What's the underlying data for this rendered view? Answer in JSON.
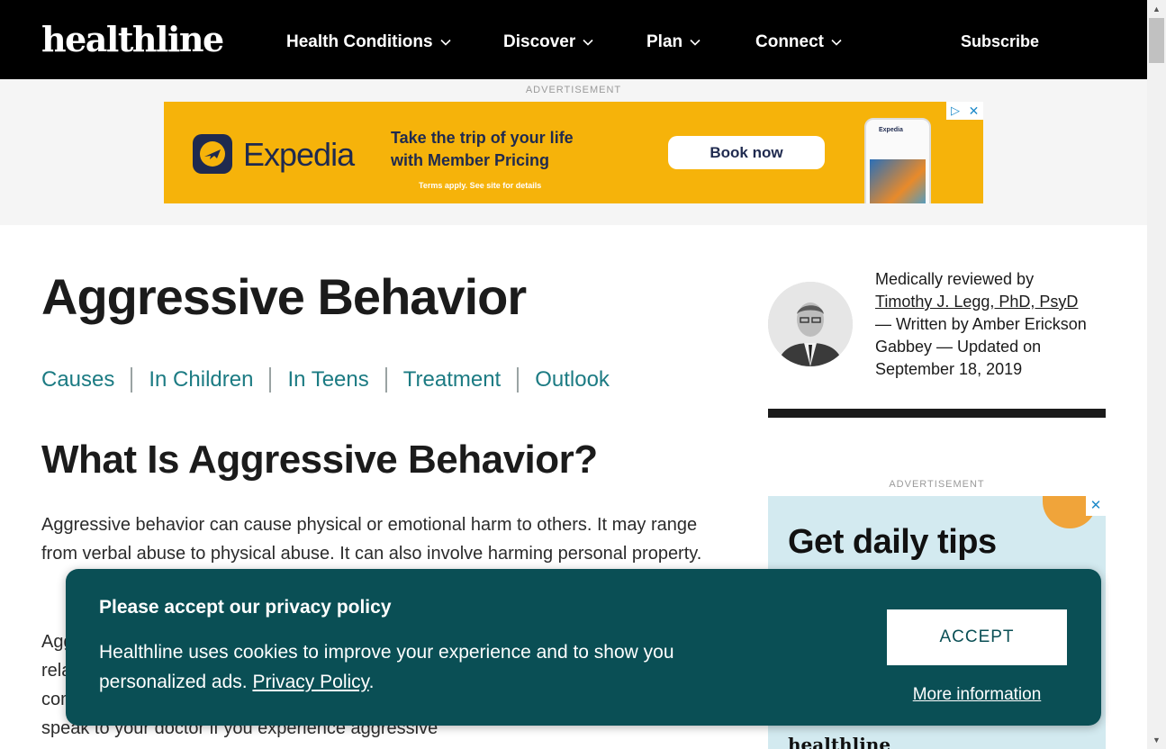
{
  "header": {
    "logo": "healthline",
    "nav": [
      {
        "label": "Health Conditions"
      },
      {
        "label": "Discover"
      },
      {
        "label": "Plan"
      },
      {
        "label": "Connect"
      }
    ],
    "subscribe_label": "Subscribe"
  },
  "top_ad": {
    "label": "ADVERTISEMENT",
    "brand": "Expedia",
    "tagline_line1": "Take the trip of your life",
    "tagline_line2": "with Member Pricing",
    "terms": "Terms apply. See site for details",
    "button": "Book now",
    "phone_header": "Expedia",
    "close": "✕",
    "adchoices": "▷"
  },
  "article": {
    "title": "Aggressive Behavior",
    "toc": [
      "Causes",
      "In Children",
      "In Teens",
      "Treatment",
      "Outlook"
    ],
    "section_title": "What Is Aggressive Behavior?",
    "para1": "Aggressive behavior can cause physical or emotional harm to others. It may range from verbal abuse to physical abuse. It can also involve harming personal property.",
    "para2": "Aggressive behavior violates social boundaries. It can lead to breakdowns in your relationships. It can be overt or secretive. Occasional outbursts of aggression are common and can even be normal in the right circumstances. However, you should speak to your doctor if you experience aggressive"
  },
  "byline": {
    "prefix": "Medically reviewed by",
    "reviewer": "Timothy J. Legg, PhD, PsyD",
    "rest": "— Written by Amber Erickson Gabbey — Updated on September 18, 2019"
  },
  "side_ad": {
    "label": "ADVERTISEMENT",
    "headline": "Get daily tips",
    "close": "✕",
    "brand": "healthline"
  },
  "cookie": {
    "title": "Please accept our privacy policy",
    "body": "Healthline uses cookies to improve your experience and to show you personalized ads. ",
    "link": "Privacy Policy",
    "after_link": ".",
    "accept": "ACCEPT",
    "more": "More information"
  },
  "colors": {
    "nav_bg": "#000000",
    "link_teal": "#1c7b83",
    "cookie_bg": "#0a4f55",
    "expedia_yellow": "#f6b30a",
    "expedia_navy": "#1f2a4f"
  }
}
